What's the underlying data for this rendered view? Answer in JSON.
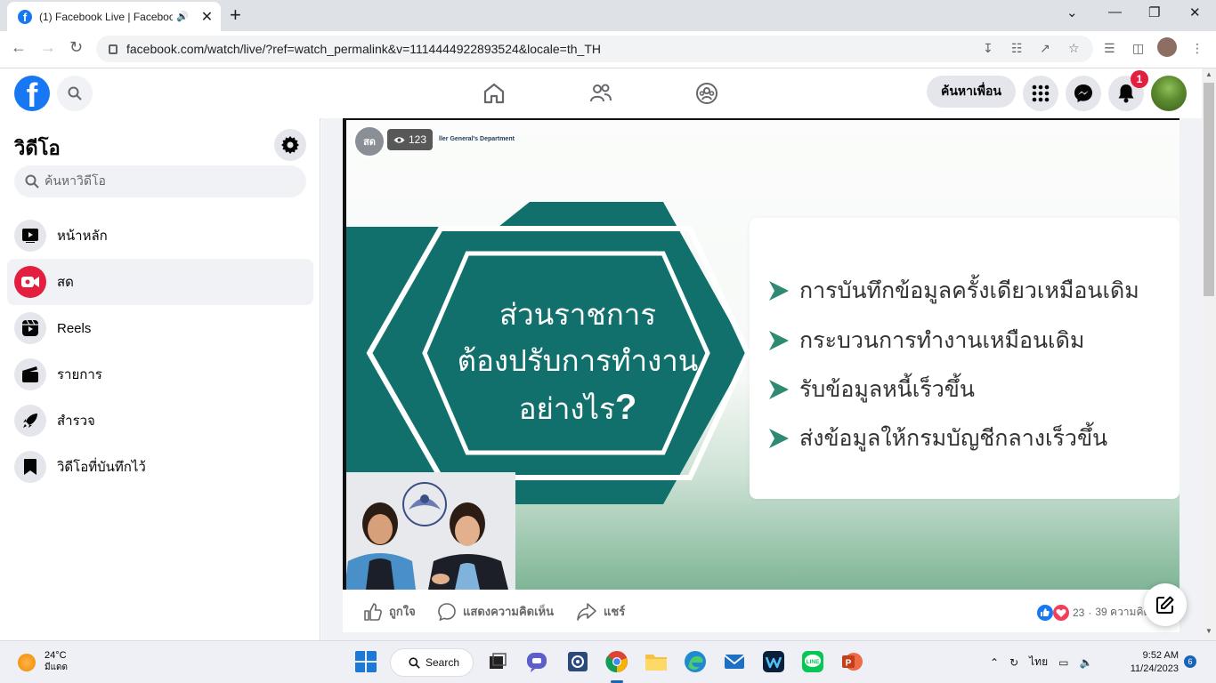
{
  "browser": {
    "tab_title": "(1) Facebook Live | Facebook",
    "new_tab": "+",
    "url": "facebook.com/watch/live/?ref=watch_permalink&v=1114444922893524&locale=th_TH"
  },
  "header": {
    "logo": "f",
    "find_friends": "ค้นหาเพื่อน",
    "notification_count": "1"
  },
  "sidebar": {
    "title": "วิดีโอ",
    "search_placeholder": "ค้นหาวิดีโอ",
    "items": [
      {
        "label": "หน้าหลัก",
        "icon": "play-icon"
      },
      {
        "label": "สด",
        "icon": "live-icon"
      },
      {
        "label": "Reels",
        "icon": "reels-icon"
      },
      {
        "label": "รายการ",
        "icon": "clapper-icon"
      },
      {
        "label": "สำรวจ",
        "icon": "rocket-icon"
      },
      {
        "label": "วิดีโอที่บันทึกไว้",
        "icon": "bookmark-icon"
      }
    ]
  },
  "video": {
    "live_badge": "สด",
    "viewers": "123",
    "dept_text": "ller General's Department",
    "slide_heading": [
      "ส่วนราชการ",
      "ต้องปรับการทำงาน",
      "อย่างไร"
    ],
    "slide_heading_mark": "?",
    "bullets": [
      "การบันทึกข้อมูลครั้งเดียวเหมือนเดิม",
      "กระบวนการทำงานเหมือนเดิม",
      "รับข้อมูลหนี้เร็วขึ้น",
      "ส่งข้อมูลให้กรมบัญชีกลางเร็วขึ้น"
    ]
  },
  "actions": {
    "like": "ถูกใจ",
    "comment": "แสดงความคิดเห็น",
    "share": "แชร์",
    "reaction_count": "23",
    "comment_count": "39 ความคิดเ"
  },
  "taskbar": {
    "temp": "24°C",
    "weather_desc": "มีแดด",
    "search": "Search",
    "language": "ไทย",
    "time": "9:52 AM",
    "date": "11/24/2023",
    "notifications": "6"
  },
  "colors": {
    "facebook_blue": "#1877f2",
    "teal": "#12706c",
    "live_red": "#e41e3f"
  }
}
